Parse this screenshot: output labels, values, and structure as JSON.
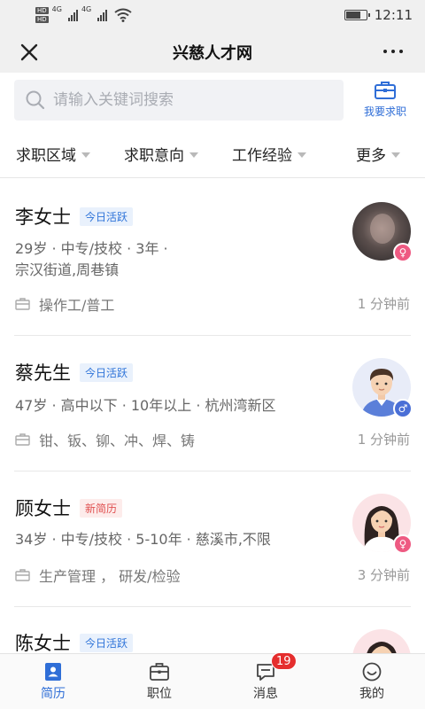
{
  "status_bar": {
    "hd_labels": [
      "HD",
      "HD"
    ],
    "network_labels": [
      "4G",
      "4G"
    ],
    "time": "12:11"
  },
  "title_bar": {
    "title": "兴慈人才网",
    "close_icon": "close-icon",
    "more_icon": "more-dots-icon"
  },
  "search": {
    "placeholder": "请输入关键词搜索",
    "value": "",
    "job_seek_label": "我要求职"
  },
  "filters": [
    {
      "label": "求职区域"
    },
    {
      "label": "求职意向"
    },
    {
      "label": "工作经验"
    },
    {
      "label": "更多"
    }
  ],
  "resumes": [
    {
      "name": "李女士",
      "badge": "今日活跃",
      "badge_color": "#2f74d9",
      "info_line1": "29岁 · 中专/技校 · 3年 ·",
      "info_line2": "宗汉街道,周巷镇",
      "job": "操作工/普工",
      "time": "1 分钟前",
      "gender": "female",
      "gender_symbol": "♀"
    },
    {
      "name": "蔡先生",
      "badge": "今日活跃",
      "badge_color": "#2f74d9",
      "info_line1": "47岁 · 高中以下 · 10年以上 · 杭州湾新区",
      "job": "钳、钣、铆、冲、焊、铸",
      "time": "1 分钟前",
      "gender": "male",
      "gender_symbol": "♂"
    },
    {
      "name": "顾女士",
      "badge": "新简历",
      "badge_color": "#e05050",
      "info_line1": "34岁 · 中专/技校 · 5-10年 · 慈溪市,不限",
      "job": "生产管理 ， 研发/检验",
      "time": "3 分钟前",
      "gender": "female",
      "gender_symbol": "♀"
    },
    {
      "name": "陈女士",
      "badge": "今日活跃",
      "badge_color": "#2f74d9",
      "gender": "female"
    }
  ],
  "bottom_nav": {
    "tabs": [
      {
        "label": "简历",
        "icon": "resume-icon",
        "active": true
      },
      {
        "label": "职位",
        "icon": "briefcase-icon",
        "active": false
      },
      {
        "label": "消息",
        "icon": "message-icon",
        "active": false,
        "badge": "19"
      },
      {
        "label": "我的",
        "icon": "profile-icon",
        "active": false
      }
    ]
  },
  "colors": {
    "accent": "#2f6ed7",
    "header_bg": "#f0f0f0",
    "female": "#ee5a82",
    "male": "#4a6fd6",
    "badge_red": "#e52e2e"
  }
}
